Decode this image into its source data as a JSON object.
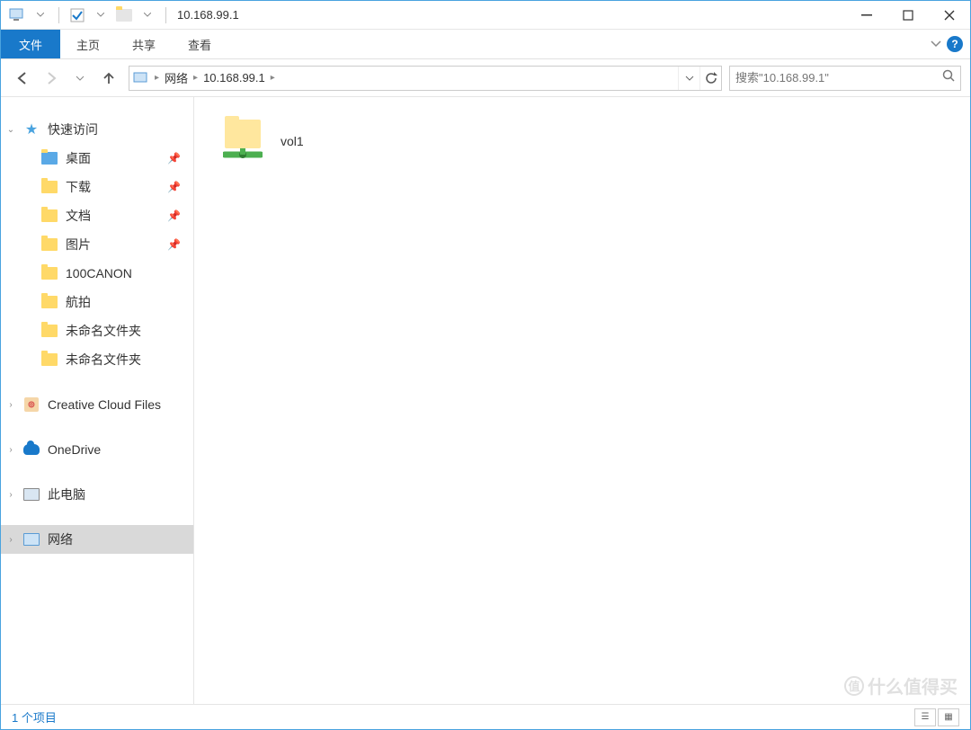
{
  "titlebar": {
    "title": "10.168.99.1"
  },
  "ribbon": {
    "file": "文件",
    "tabs": [
      "主页",
      "共享",
      "查看"
    ]
  },
  "breadcrumb": {
    "segments": [
      "网络",
      "10.168.99.1"
    ]
  },
  "search": {
    "placeholder": "搜索\"10.168.99.1\""
  },
  "sidebar": {
    "quick_access": "快速访问",
    "quick_items": [
      {
        "label": "桌面",
        "pinned": true
      },
      {
        "label": "下载",
        "pinned": true
      },
      {
        "label": "文档",
        "pinned": true
      },
      {
        "label": "图片",
        "pinned": true
      },
      {
        "label": "100CANON",
        "pinned": false
      },
      {
        "label": "航拍",
        "pinned": false
      },
      {
        "label": "未命名文件夹",
        "pinned": false
      },
      {
        "label": "未命名文件夹",
        "pinned": false
      }
    ],
    "creative_cloud": "Creative Cloud Files",
    "onedrive": "OneDrive",
    "this_pc": "此电脑",
    "network": "网络"
  },
  "content": {
    "items": [
      {
        "label": "vol1"
      }
    ]
  },
  "statusbar": {
    "count": "1 个项目"
  },
  "watermark": "什么值得买"
}
